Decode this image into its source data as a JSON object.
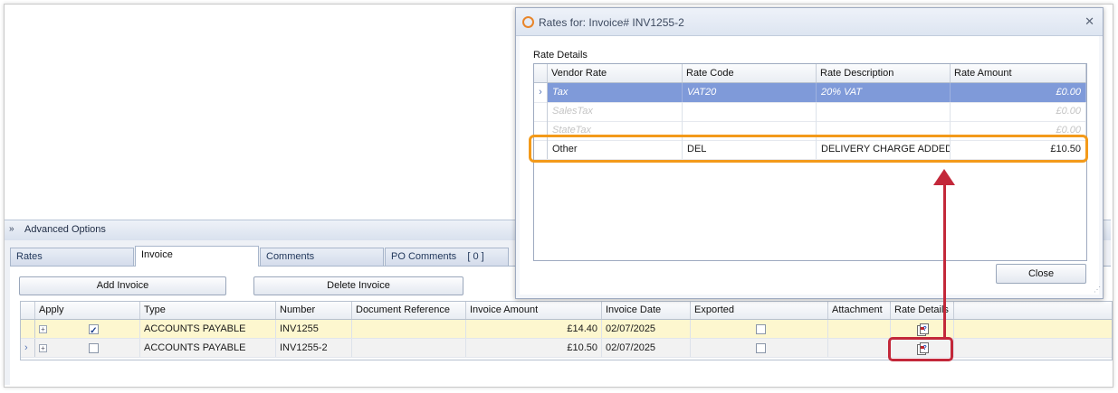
{
  "advanced": {
    "label": "Advanced Options"
  },
  "tabs": [
    {
      "label": "Rates"
    },
    {
      "label": "Invoice"
    },
    {
      "label": "Comments"
    },
    {
      "label": "PO Comments",
      "count": "[ 0 ]"
    }
  ],
  "buttons": {
    "add_invoice": "Add Invoice",
    "delete_invoice": "Delete Invoice"
  },
  "invoice_grid": {
    "headers": [
      "Apply",
      "Type",
      "Number",
      "Document Reference",
      "Invoice Amount",
      "Invoice Date",
      "Exported",
      "Attachment",
      "Rate Details"
    ],
    "rows": [
      {
        "apply": true,
        "type": "ACCOUNTS PAYABLE",
        "number": "INV1255",
        "doc_ref": "",
        "amount": "£14.40",
        "date": "02/07/2025",
        "exported": false
      },
      {
        "apply": false,
        "type": "ACCOUNTS PAYABLE",
        "number": "INV1255-2",
        "doc_ref": "",
        "amount": "£10.50",
        "date": "02/07/2025",
        "exported": false
      }
    ]
  },
  "dialog": {
    "title": "Rates for: Invoice# INV1255-2",
    "section_label": "Rate Details",
    "close_label": "Close",
    "headers": [
      "Vendor Rate",
      "Rate Code",
      "Rate Description",
      "Rate Amount"
    ],
    "rows": [
      {
        "vendor_rate": "Tax",
        "rate_code": "VAT20",
        "description": "20% VAT",
        "amount": "£0.00"
      },
      {
        "vendor_rate": "SalesTax",
        "rate_code": "",
        "description": "",
        "amount": "£0.00"
      },
      {
        "vendor_rate": "StateTax",
        "rate_code": "",
        "description": "",
        "amount": "£0.00"
      },
      {
        "vendor_rate": "Other",
        "rate_code": "DEL",
        "description": "DELIVERY CHARGE ADDED ...",
        "amount": "£10.50"
      }
    ]
  },
  "colors": {
    "selection": "#7f9ad9",
    "highlight_orange": "#f39a1a",
    "highlight_red": "#c3283a",
    "yellow_row": "#fdf7cf"
  },
  "icons": [
    "chevron-down-icon",
    "close-icon",
    "rate-details-icon",
    "expand-icon",
    "dialog-icon"
  ]
}
